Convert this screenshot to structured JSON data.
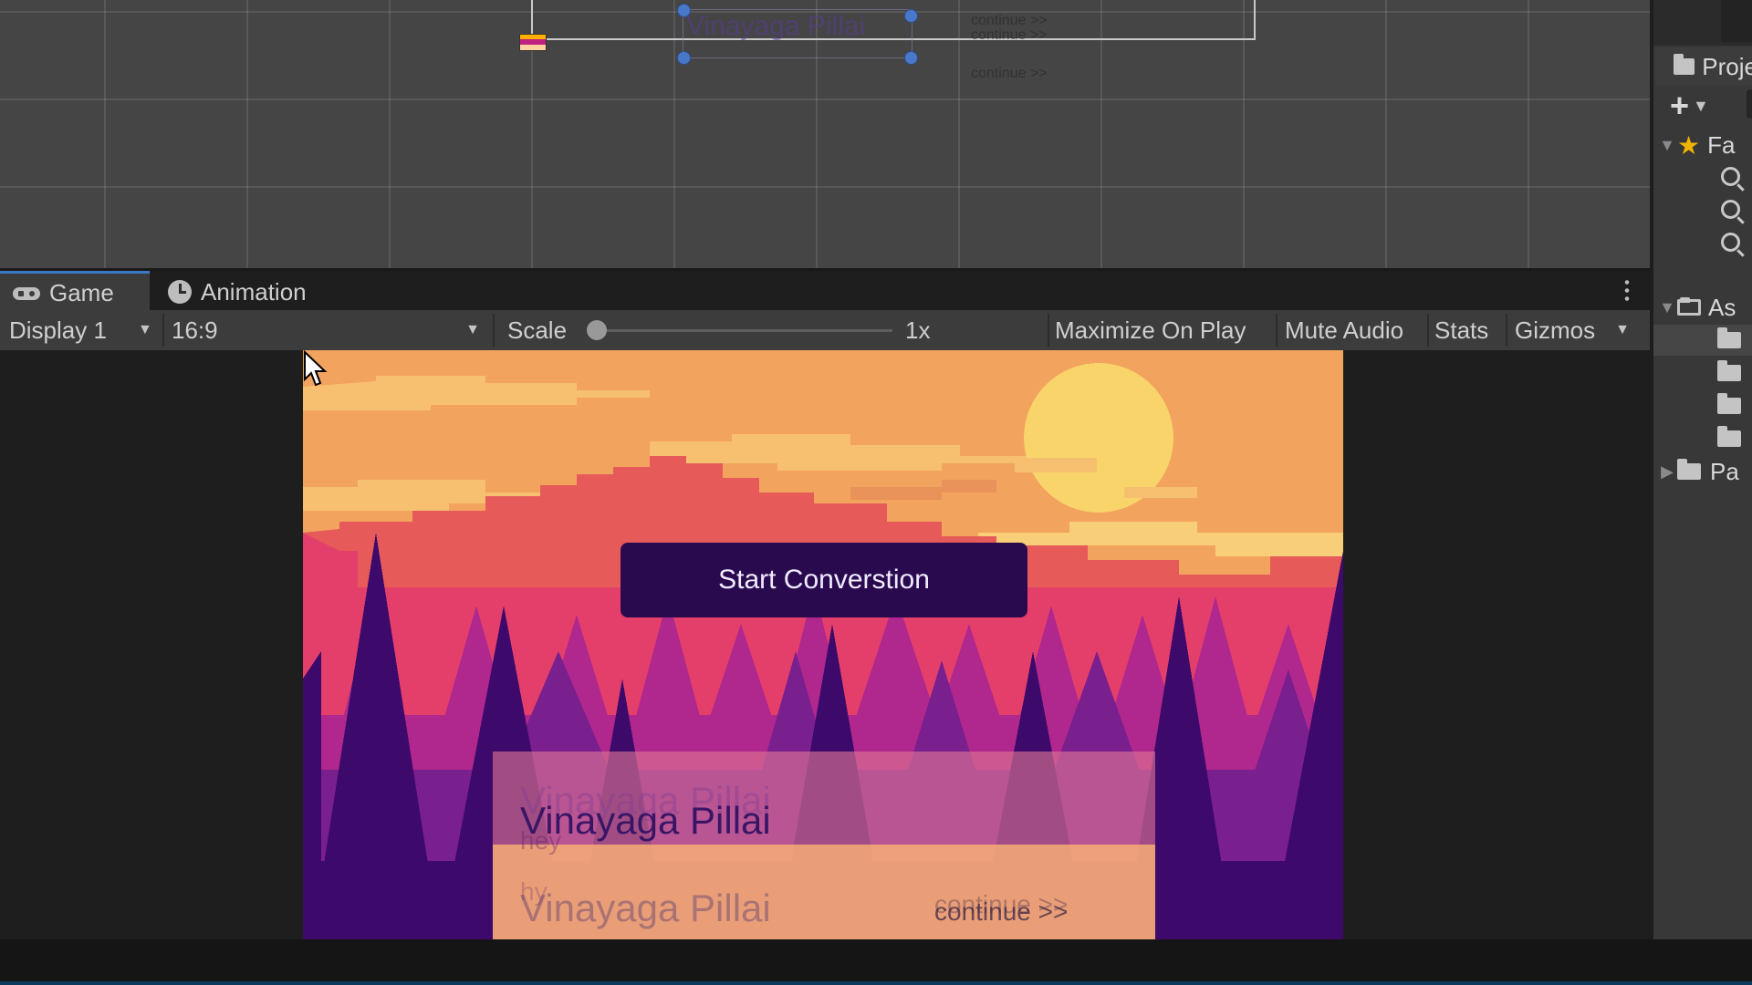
{
  "scene_view": {
    "name_text": "Vinayaga Pillai",
    "faint_labels": [
      "continue >>",
      "continue >>",
      "continue >>"
    ]
  },
  "project_panel": {
    "tab_label": "Proje",
    "favorites_label": "Fa",
    "assets_label": "As",
    "packages_label": "Pa"
  },
  "tabs": [
    {
      "label": "Game",
      "icon": "gamepad-icon",
      "active": true
    },
    {
      "label": "Animation",
      "icon": "clock-icon",
      "active": false
    }
  ],
  "toolbar": {
    "display": "Display 1",
    "aspect": "16:9",
    "scale_label": "Scale",
    "scale_value": "1x",
    "scale_slider_fraction": 0.0,
    "maximize_on_play": "Maximize On Play",
    "mute_audio": "Mute Audio",
    "stats": "Stats",
    "gizmos": "Gizmos"
  },
  "game": {
    "start_button_label": "Start Converstion",
    "dialogue": {
      "name_ghost": "Vinayaga Pillai",
      "name": "Vinayaga Pillai",
      "line_ghost": "hey",
      "name_bottom": "Vinayaga Pillai",
      "line_bottom_ghost": "hy",
      "continue_ghost": "continue >>",
      "continue": "continue >>"
    }
  },
  "colors": {
    "accent_tab": "#3a79c8",
    "button_bg": "#2a0a4e",
    "sky": "#f2a35e",
    "sun": "#f8d46a"
  }
}
